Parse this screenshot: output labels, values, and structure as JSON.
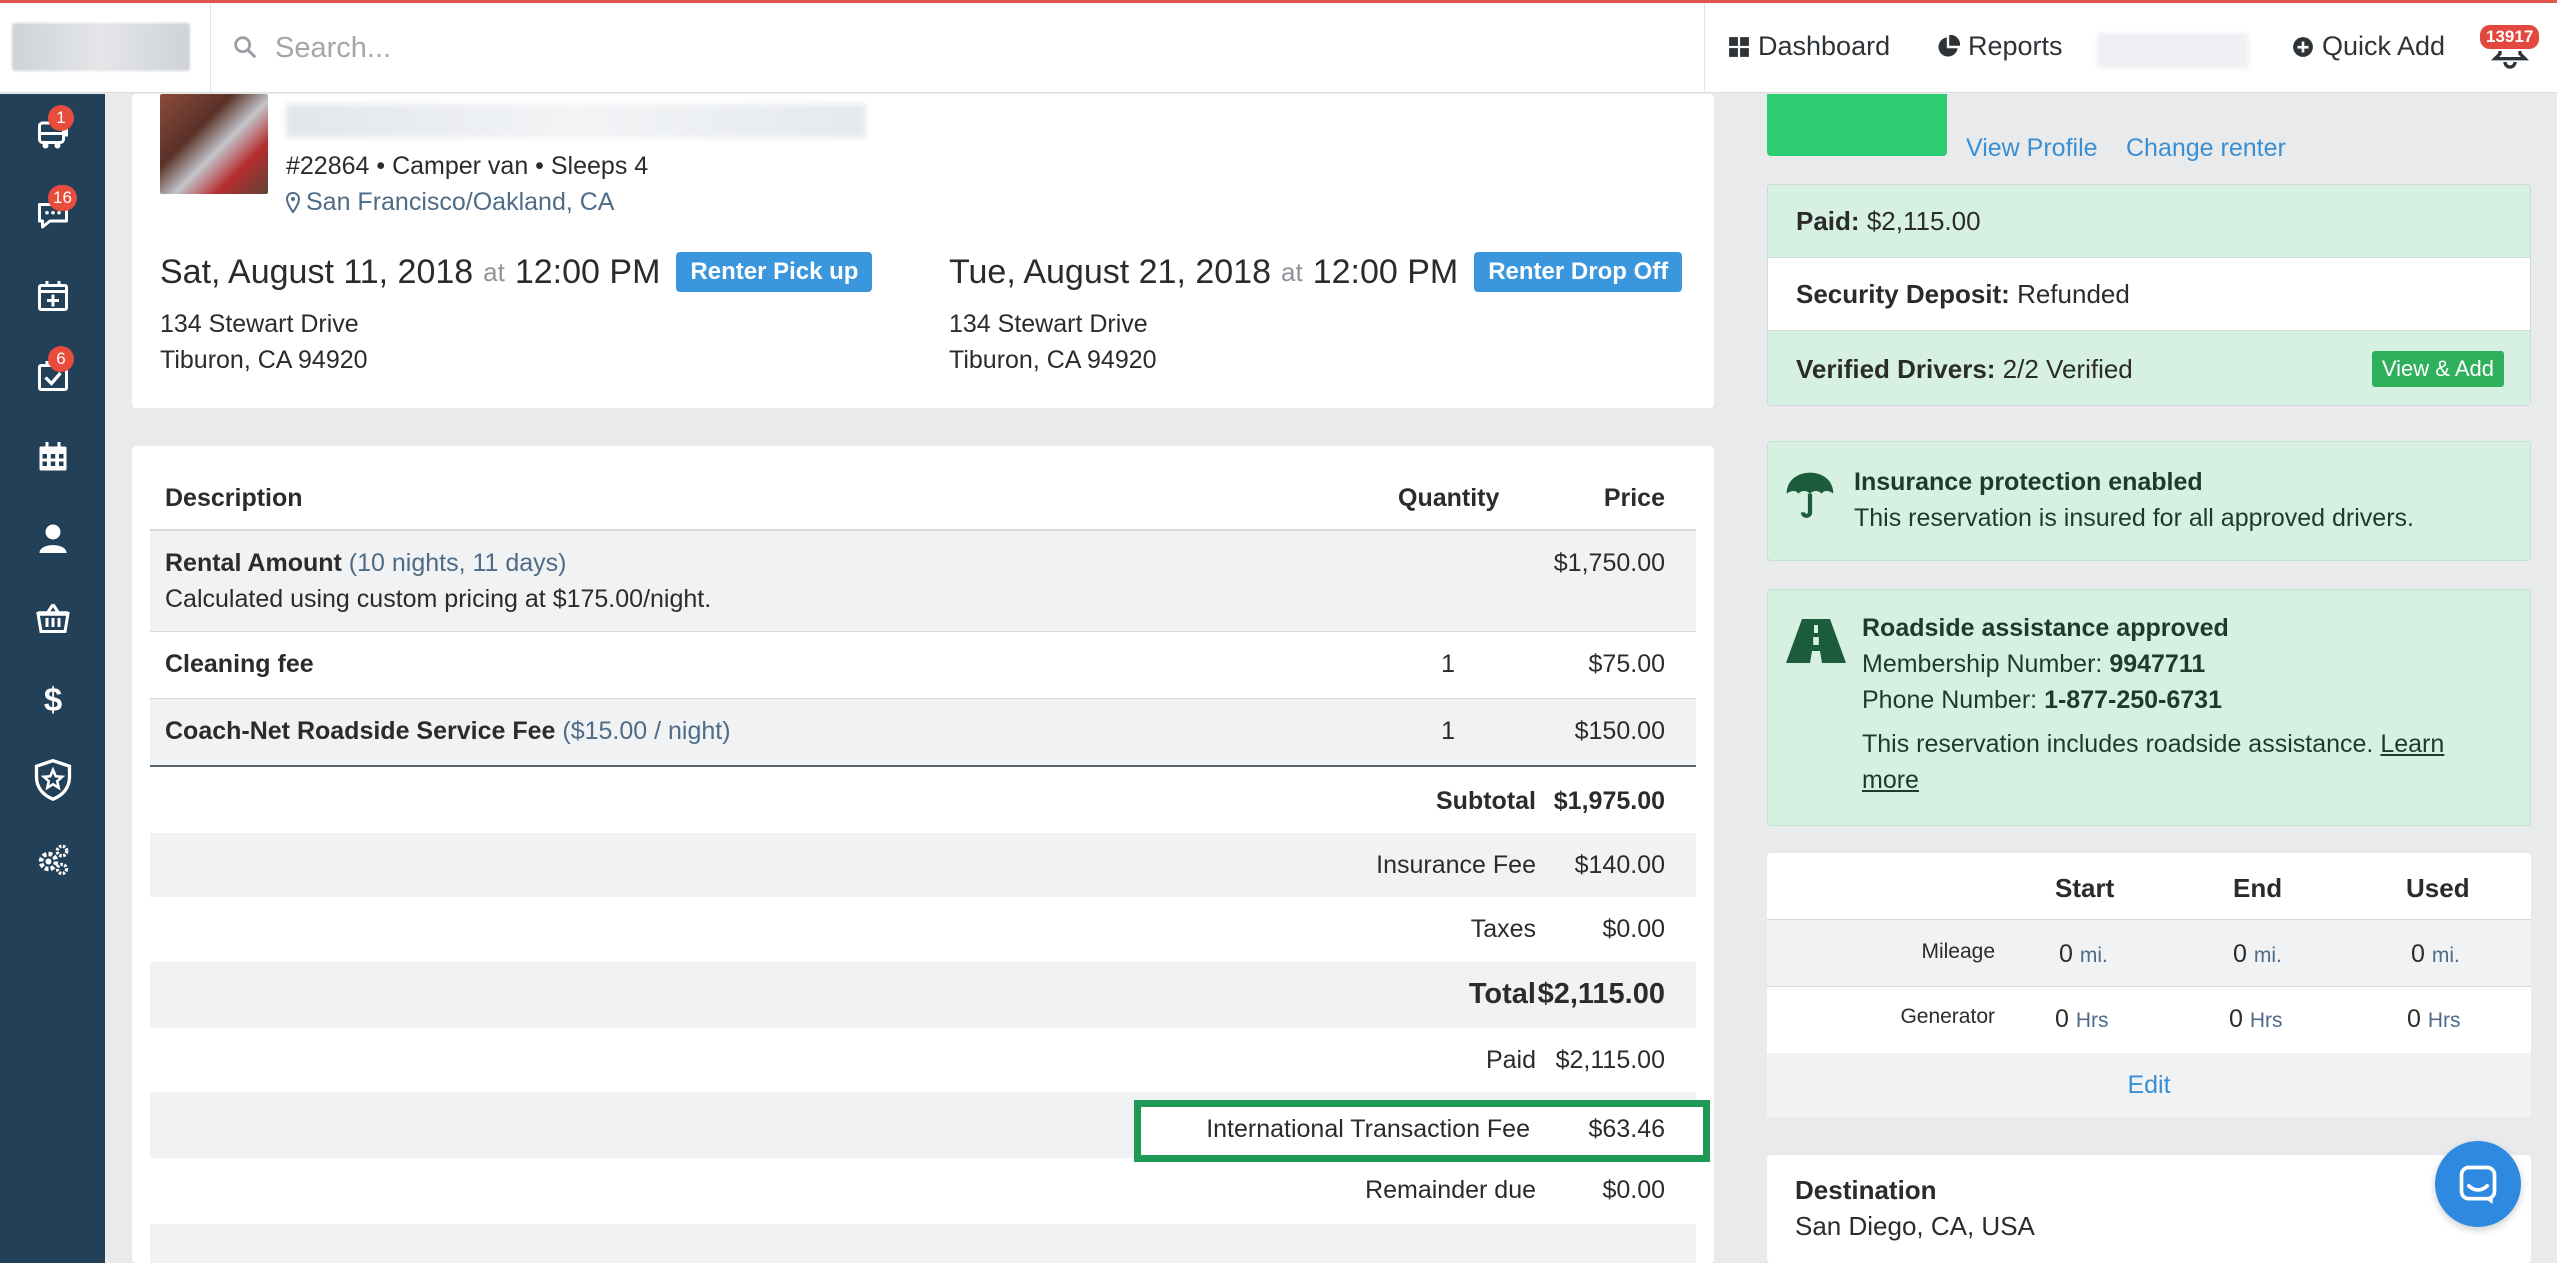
{
  "header": {
    "search_placeholder": "Search...",
    "nav": {
      "dashboard": "Dashboard",
      "reports": "Reports",
      "quick_add": "Quick Add"
    },
    "notifications_count": "13917"
  },
  "sidebar": {
    "items": [
      {
        "name": "vehicles",
        "badge": "1"
      },
      {
        "name": "messages",
        "badge": "16"
      },
      {
        "name": "new-booking",
        "badge": ""
      },
      {
        "name": "tasks",
        "badge": "6"
      },
      {
        "name": "calendar",
        "badge": ""
      },
      {
        "name": "customers",
        "badge": ""
      },
      {
        "name": "store",
        "badge": ""
      },
      {
        "name": "payments",
        "badge": ""
      },
      {
        "name": "insurance",
        "badge": ""
      },
      {
        "name": "settings",
        "badge": ""
      }
    ]
  },
  "vehicle": {
    "meta": "#22864 • Camper van • Sleeps 4",
    "location": "San Francisco/Oakland, CA"
  },
  "pickup": {
    "date": "Sat, August 11, 2018",
    "at": "at",
    "time": "12:00 PM",
    "badge": "Renter Pick up",
    "address_line1": "134 Stewart Drive",
    "address_line2": "Tiburon, CA 94920"
  },
  "dropoff": {
    "date": "Tue, August 21, 2018",
    "at": "at",
    "time": "12:00 PM",
    "badge": "Renter Drop Off",
    "address_line1": "134 Stewart Drive",
    "address_line2": "Tiburon, CA 94920"
  },
  "pricing": {
    "headers": {
      "description": "Description",
      "quantity": "Quantity",
      "price": "Price"
    },
    "items": [
      {
        "name": "Rental Amount",
        "detail": "(10 nights, 11 days)",
        "note": "Calculated using custom pricing at $175.00/night.",
        "quantity": "",
        "price": "$1,750.00"
      },
      {
        "name": "Cleaning fee",
        "detail": "",
        "note": "",
        "quantity": "1",
        "price": "$75.00"
      },
      {
        "name": "Coach-Net Roadside Service Fee",
        "detail": "($15.00 / night)",
        "note": "",
        "quantity": "1",
        "price": "$150.00"
      }
    ],
    "summary": [
      {
        "label": "Subtotal",
        "value": "$1,975.00",
        "bold": true
      },
      {
        "label": "Insurance Fee",
        "value": "$140.00",
        "bold": false
      },
      {
        "label": "Taxes",
        "value": "$0.00",
        "bold": false
      },
      {
        "label": "Total",
        "value": "$2,115.00",
        "bold": true
      },
      {
        "label": "Paid",
        "value": "$2,115.00",
        "bold": false
      },
      {
        "label": "International Transaction Fee",
        "value": "$63.46",
        "bold": false
      },
      {
        "label": "Remainder due",
        "value": "$0.00",
        "bold": false
      }
    ]
  },
  "renter": {
    "view_profile": "View Profile",
    "change_renter": "Change renter"
  },
  "payment": {
    "paid_label": "Paid:",
    "paid_value": "$2,115.00",
    "deposit_label": "Security Deposit:",
    "deposit_value": "Refunded",
    "drivers_label": "Verified Drivers:",
    "drivers_value": "2/2 Verified",
    "view_add": "View & Add"
  },
  "insurance": {
    "title": "Insurance protection enabled",
    "text": "This reservation is insured for all approved drivers."
  },
  "roadside": {
    "title": "Roadside assistance approved",
    "membership_label": "Membership Number:",
    "membership_value": "9947711",
    "phone_label": "Phone Number:",
    "phone_value": "1-877-250-6731",
    "text": "This reservation includes roadside assistance.",
    "learn": "Learn",
    "more": "more"
  },
  "usage": {
    "headers": {
      "start": "Start",
      "end": "End",
      "used": "Used"
    },
    "rows": [
      {
        "label": "Mileage",
        "start": "0",
        "end": "0",
        "used": "0",
        "unit": "mi."
      },
      {
        "label": "Generator",
        "start": "0",
        "end": "0",
        "used": "0",
        "unit": "Hrs"
      }
    ],
    "edit": "Edit"
  },
  "destination": {
    "label": "Destination",
    "value": "San Diego, CA, USA"
  },
  "colors": {
    "sidebar": "#234059",
    "accent_blue": "#3a96dd",
    "success_green": "#1f9a55",
    "light_green": "#d6f1e2",
    "badge_red": "#e74c3c"
  }
}
